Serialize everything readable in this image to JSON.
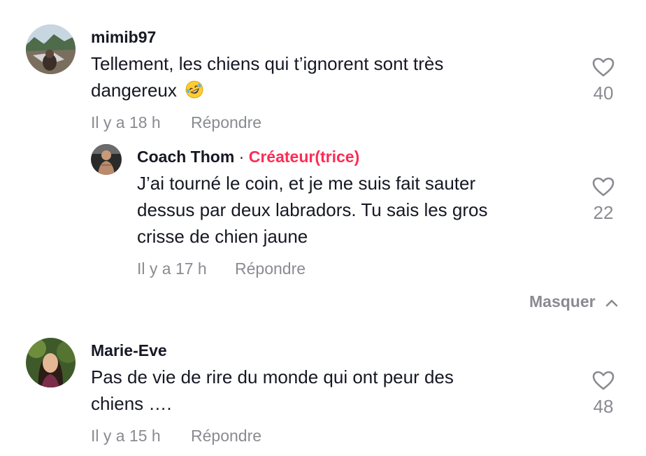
{
  "comments": [
    {
      "username": "mimib97",
      "text_line1": "Tellement, les chiens qui t’ignorent sont très",
      "text_line2": "dangereux",
      "emoji": "rolling-on-floor-laughing",
      "time": "Il y a 18 h",
      "reply_label": "Répondre",
      "likes": "40"
    },
    {
      "username": "Coach Thom",
      "separator": "·",
      "creator_badge": "Créateur(trice)",
      "text_line1": "J’ai tourné le coin, et je me suis fait sauter",
      "text_line2": "dessus par deux labradors. Tu sais les gros",
      "text_line3": "crisse de chien jaune",
      "time": "Il y a 17 h",
      "reply_label": "Répondre",
      "likes": "22"
    },
    {
      "username": "Marie-Eve",
      "text_line1": "Pas de vie de rire du monde qui ont peur des",
      "text_line2": "chiens ….",
      "time": "Il y a 15 h",
      "reply_label": "Répondre",
      "likes": "48"
    }
  ],
  "hide_replies_label": "Masquer",
  "colors": {
    "creator": "#fe2c55",
    "secondary": "#8a8b91",
    "text": "#161823"
  }
}
